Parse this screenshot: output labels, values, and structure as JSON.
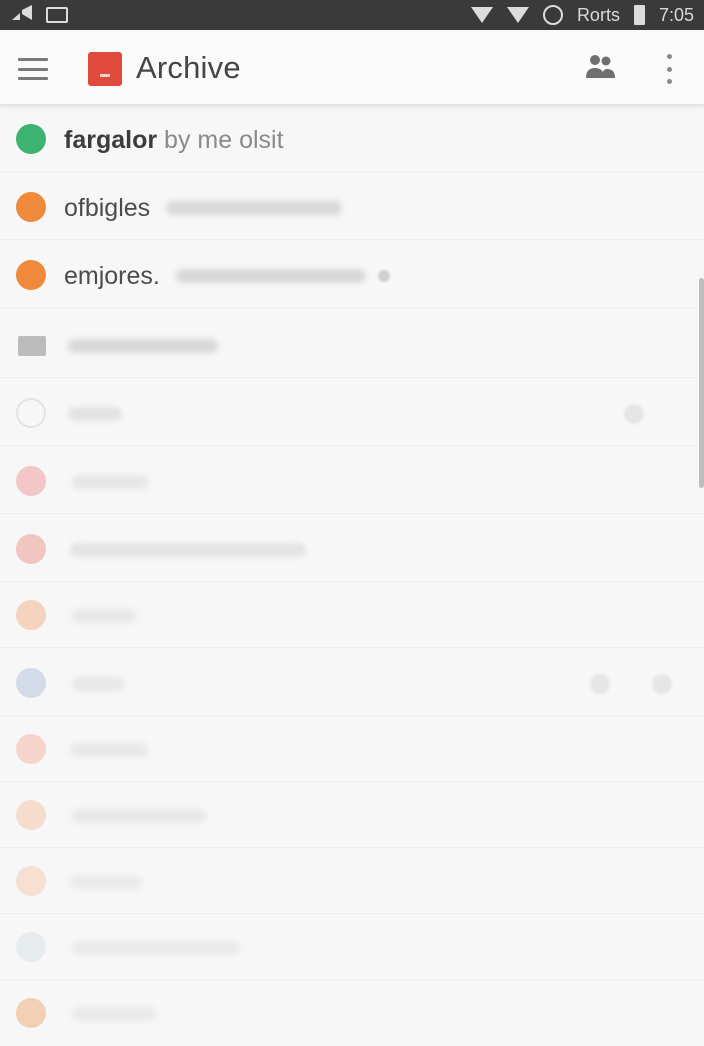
{
  "status_bar": {
    "carrier": "Rorts",
    "time": "7:05"
  },
  "app_bar": {
    "title": "Archive"
  },
  "list": {
    "rows": [
      {
        "sender": "fargalor",
        "snippet": "by me olsit",
        "dot_color": "#3cb371"
      },
      {
        "sender": "ofbigles",
        "snippet": "",
        "dot_color": "#ef8a3c"
      },
      {
        "sender": "emjores.",
        "snippet": "",
        "dot_color": "#ef8a3c"
      }
    ]
  },
  "colors": {
    "status_bar": "#3a3a3a",
    "accent": "#e04a3c",
    "green_dot": "#3cb371",
    "orange_dot": "#ef8a3c"
  }
}
